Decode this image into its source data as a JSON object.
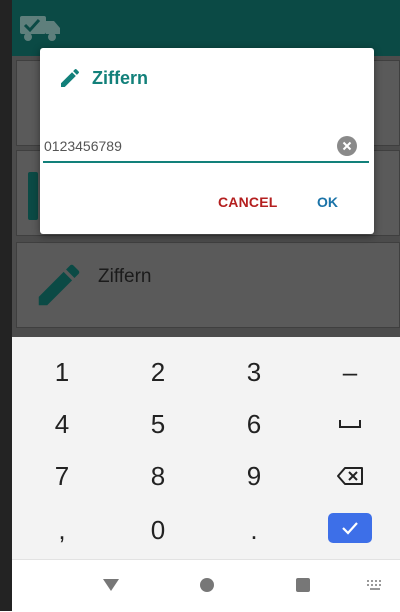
{
  "background_app": {
    "list_items": [
      {
        "label": ""
      },
      {
        "label": ""
      },
      {
        "label": "Ziffern",
        "icon": "pencil-icon"
      }
    ],
    "toolbar_icon": "truck-check-icon"
  },
  "dialog": {
    "title": "Ziffern",
    "icon": "pencil-icon",
    "input_value": "0123456789",
    "cancel_label": "CANCEL",
    "ok_label": "OK",
    "accent_color": "#12807a"
  },
  "keyboard": {
    "rows": [
      [
        "1",
        "2",
        "3",
        "–"
      ],
      [
        "4",
        "5",
        "6",
        "space-icon"
      ],
      [
        "7",
        "8",
        "9",
        "backspace-icon"
      ],
      [
        ",",
        "0",
        ".",
        "done-icon"
      ]
    ],
    "accent_color": "#3d6fe8"
  },
  "navbar": {
    "buttons": [
      "back-icon",
      "home-icon",
      "recents-icon",
      "keyboard-switch-icon"
    ]
  }
}
